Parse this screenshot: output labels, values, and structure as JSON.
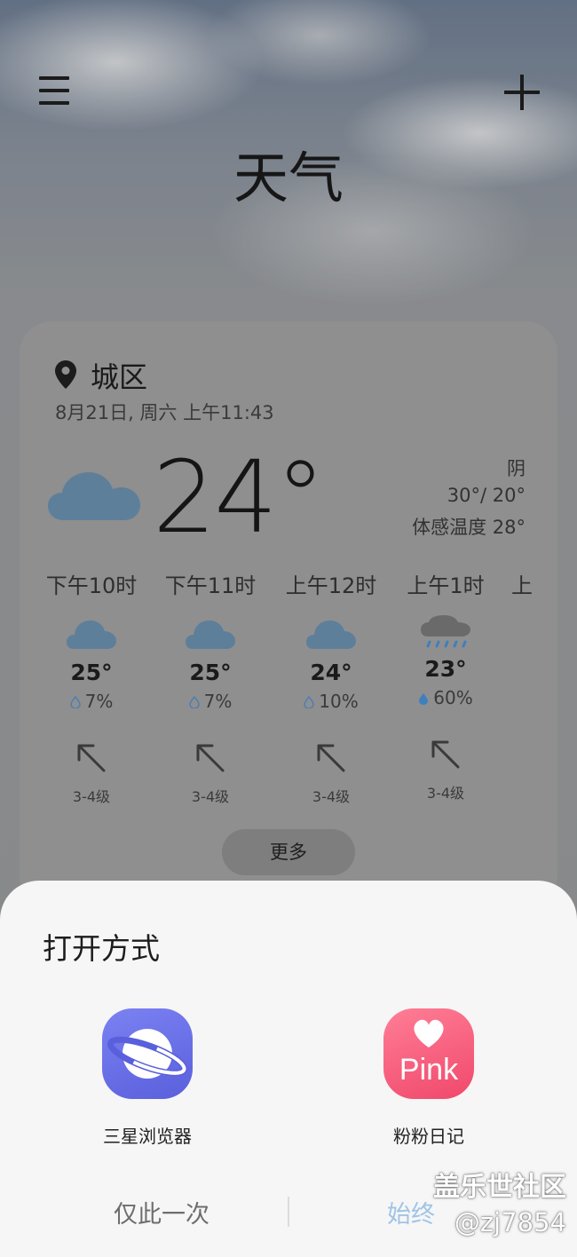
{
  "header": {
    "title": "天气",
    "menu_icon": "menu-icon",
    "add_icon": "add-icon"
  },
  "current": {
    "location": "城区",
    "datetime": "8月21日, 周六 上午11:43",
    "temperature": "24°",
    "condition": "阴",
    "high_low": "30°/ 20°",
    "feels_like": "体感温度 28°",
    "icon": "cloud-icon"
  },
  "hourly": [
    {
      "time": "下午10时",
      "temp": "25°",
      "precip": "7%",
      "wind": "3-4级",
      "icon": "cloud-icon"
    },
    {
      "time": "下午11时",
      "temp": "25°",
      "precip": "7%",
      "wind": "3-4级",
      "icon": "cloud-icon"
    },
    {
      "time": "上午12时",
      "temp": "24°",
      "precip": "10%",
      "wind": "3-4级",
      "icon": "cloud-icon"
    },
    {
      "time": "上午1时",
      "temp": "23°",
      "precip": "60%",
      "wind": "3-4级",
      "icon": "rain-cloud-icon"
    },
    {
      "time": "上",
      "temp": "",
      "precip": "",
      "wind": "",
      "icon": ""
    }
  ],
  "more_button": "更多",
  "sheet": {
    "title": "打开方式",
    "apps": [
      {
        "label": "三星浏览器",
        "icon": "samsung-internet-icon",
        "color": "#6a70e6"
      },
      {
        "label": "粉粉日记",
        "icon": "pink-diary-icon",
        "color": "#f5577a",
        "icon_text": "Pink"
      }
    ],
    "once_label": "仅此一次",
    "always_label": "始终"
  },
  "watermark": {
    "brand": "盖乐世社区",
    "user": "@zj7854"
  },
  "colors": {
    "cloud": "#5e7f9a",
    "rain_drop": "#3e7fbf",
    "always_text": "#9fc4e6"
  }
}
